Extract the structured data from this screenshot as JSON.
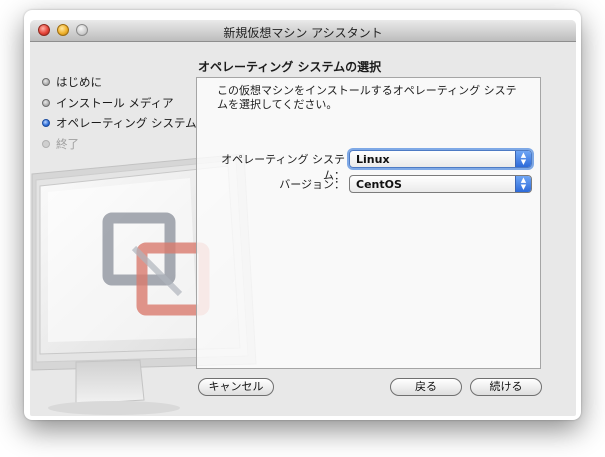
{
  "window": {
    "title": "新規仮想マシン アシスタント"
  },
  "sidebar": {
    "steps": [
      {
        "label": "はじめに",
        "state": "done"
      },
      {
        "label": "インストール メディア",
        "state": "done"
      },
      {
        "label": "オペレーティング システム",
        "state": "current"
      },
      {
        "label": "終了",
        "state": "pending"
      }
    ]
  },
  "main": {
    "heading": "オペレーティング システムの選択",
    "description_line1": "この仮想マシンをインストールするオペレーティング システ",
    "description_line2": "ムを選択してください。",
    "os_label": "オペレーティング システム：",
    "os_value": "Linux",
    "version_label": "バージョン：",
    "version_value": "CentOS"
  },
  "buttons": {
    "cancel": "キャンセル",
    "back": "戻る",
    "continue": "続ける"
  },
  "colors": {
    "accent": "#2d6ad9",
    "window_bg": "#e8e8e8"
  }
}
